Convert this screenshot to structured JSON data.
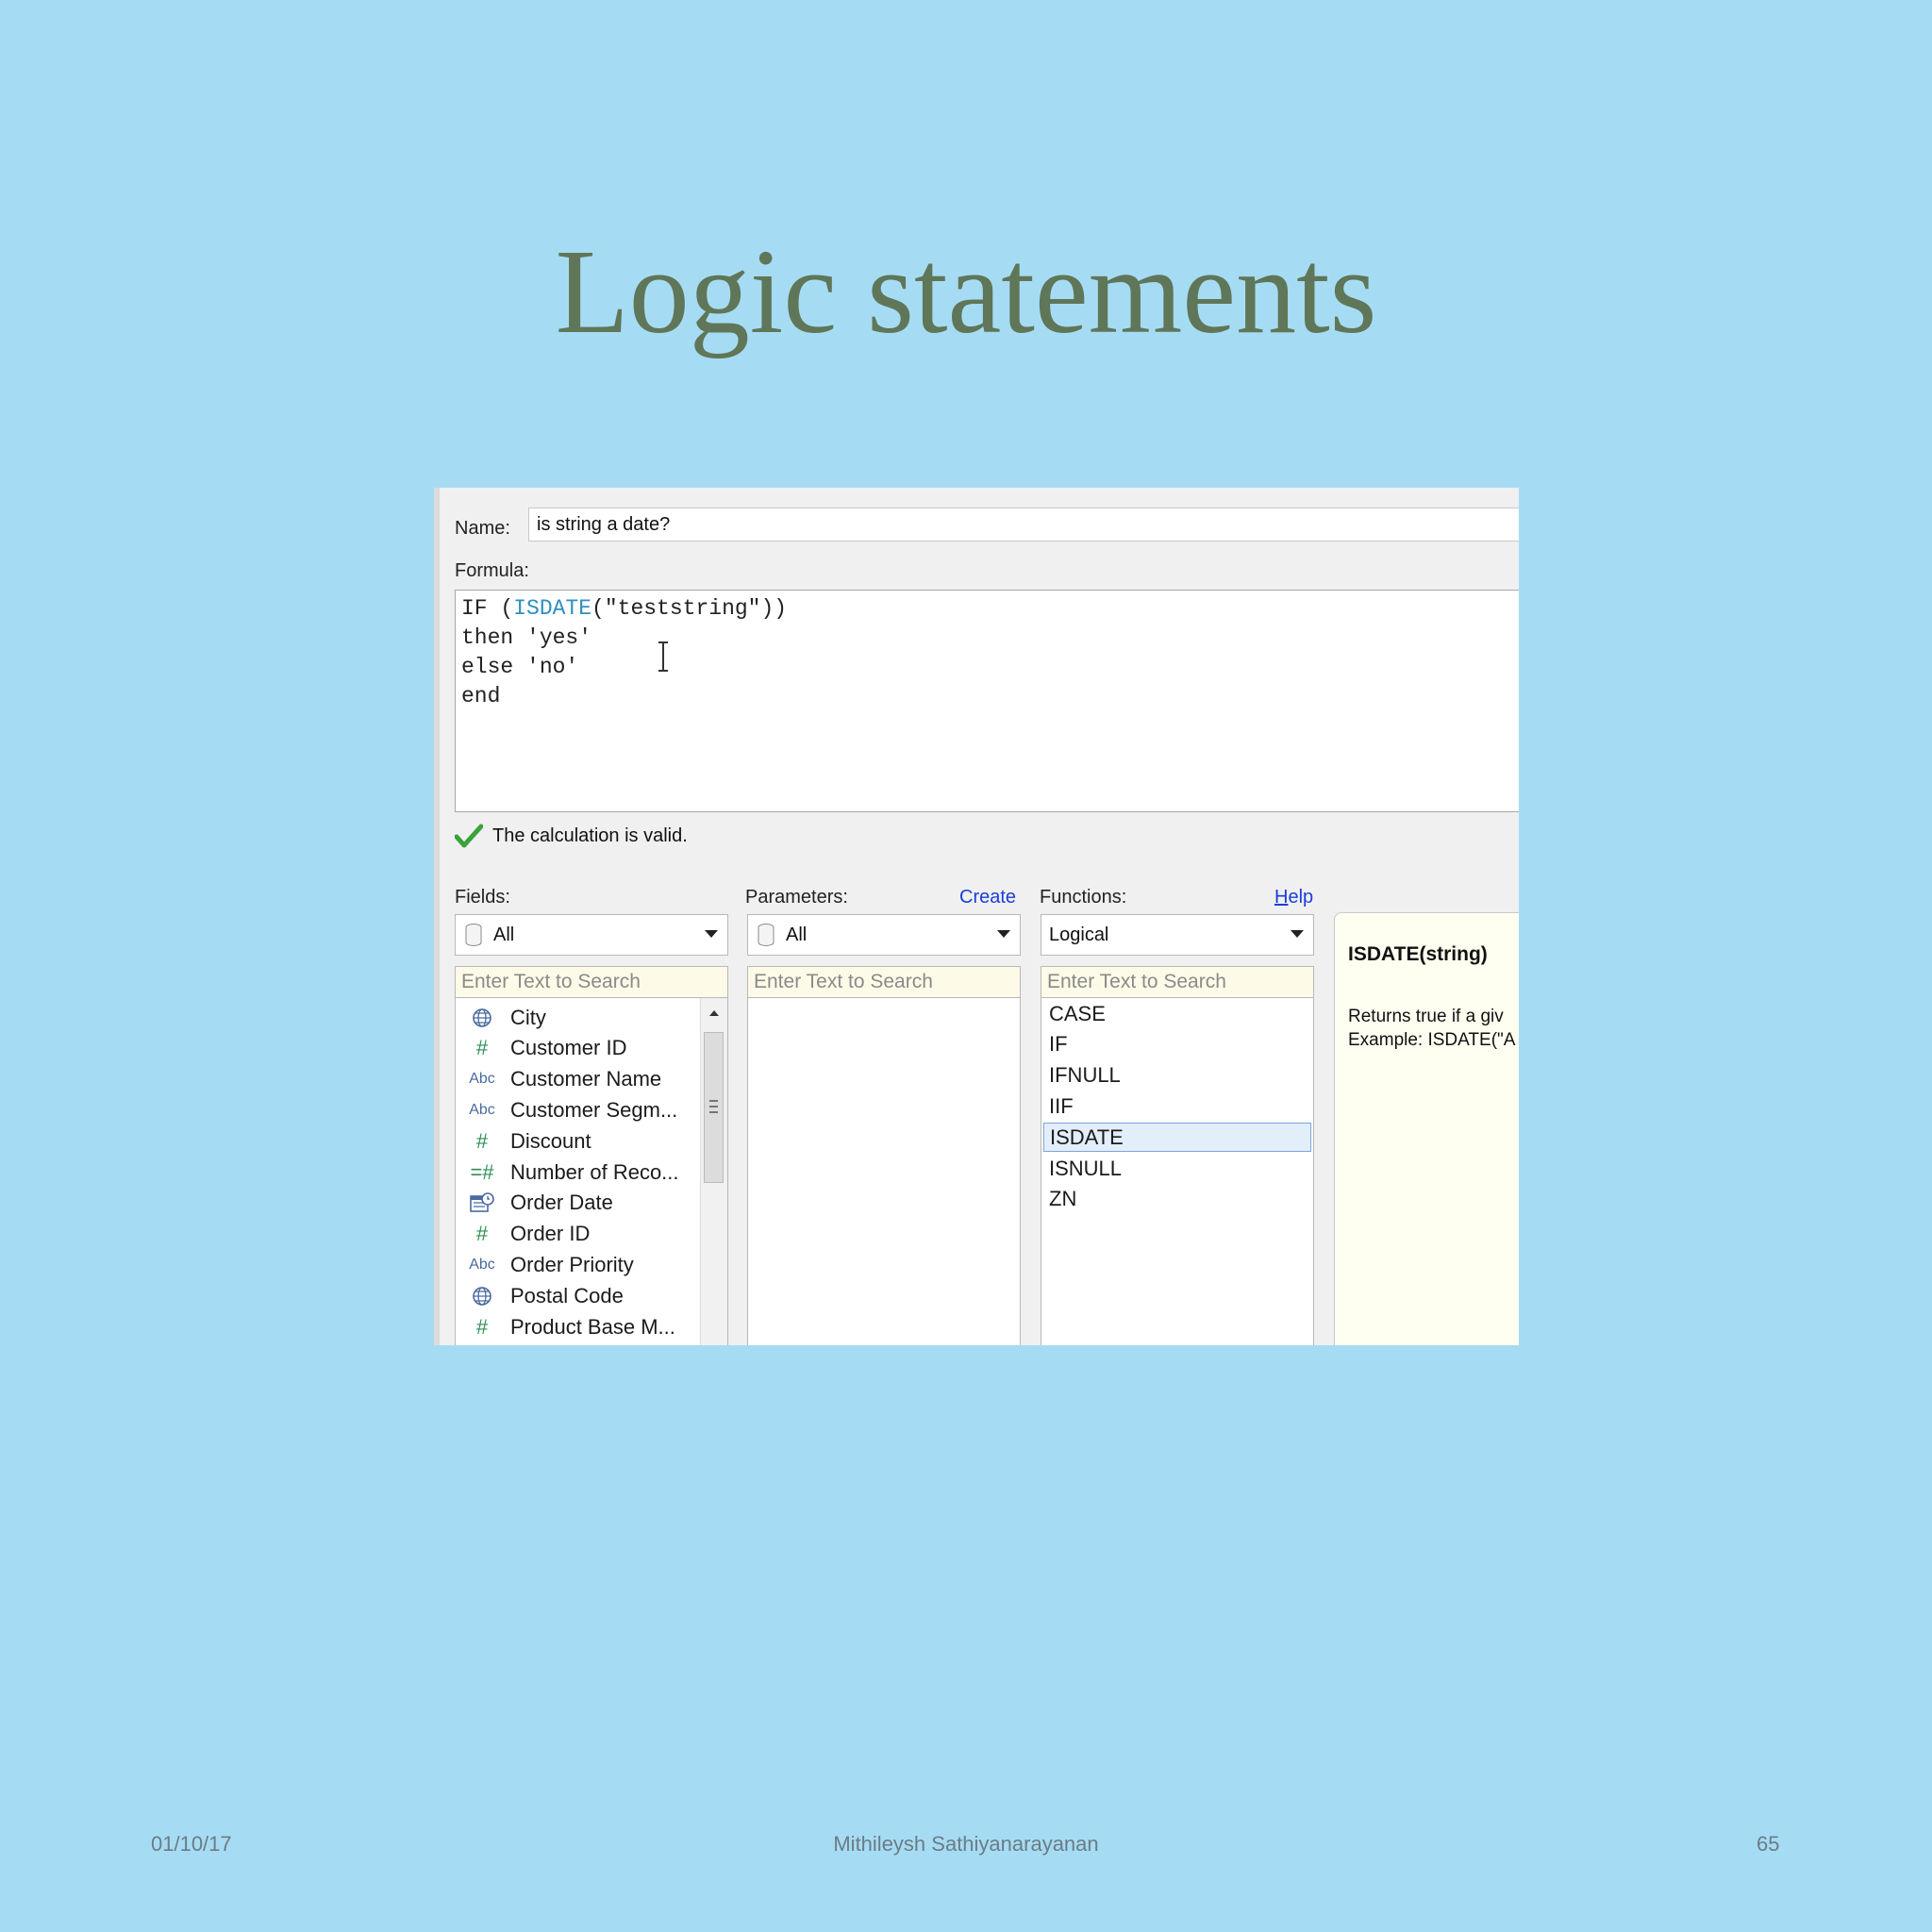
{
  "slide": {
    "title": "Logic statements",
    "footer": {
      "date": "01/10/17",
      "author": "Mithileysh Sathiyanarayanan",
      "page": "65"
    }
  },
  "dialog": {
    "name_label": "Name:",
    "name_value": "is string a date?",
    "formula_label": "Formula:",
    "formula": {
      "line1_kw": "IF (",
      "line1_fn": "ISDATE",
      "line1_rest": "(\"teststring\"))",
      "line2": "then 'yes'",
      "line3": "else 'no'",
      "line4": "end"
    },
    "valid_message": "The calculation is valid.",
    "fields": {
      "label": "Fields:",
      "filter": "All",
      "search_placeholder": "Enter Text to Search",
      "items": [
        {
          "icon": "globe-icon",
          "label": "City"
        },
        {
          "icon": "number-icon",
          "label": "Customer ID"
        },
        {
          "icon": "string-icon",
          "label": "Customer Name"
        },
        {
          "icon": "string-icon",
          "label": "Customer Segm..."
        },
        {
          "icon": "number-icon",
          "label": "Discount"
        },
        {
          "icon": "calculated-number-icon",
          "label": "Number of Reco..."
        },
        {
          "icon": "date-icon",
          "label": "Order Date"
        },
        {
          "icon": "number-icon",
          "label": "Order ID"
        },
        {
          "icon": "string-icon",
          "label": "Order Priority"
        },
        {
          "icon": "globe-icon",
          "label": "Postal Code"
        },
        {
          "icon": "number-icon",
          "label": "Product Base M..."
        }
      ]
    },
    "parameters": {
      "label": "Parameters:",
      "create_link": "Create",
      "filter": "All",
      "search_placeholder": "Enter Text to Search"
    },
    "functions": {
      "label": "Functions:",
      "help_link": "Help",
      "filter": "Logical",
      "search_placeholder": "Enter Text to Search",
      "items": [
        "CASE",
        "IF",
        "IFNULL",
        "IIF",
        "ISDATE",
        "ISNULL",
        "ZN"
      ],
      "selected": "ISDATE"
    },
    "help": {
      "title": "ISDATE(string)",
      "desc_line1": "Returns true if a giv",
      "desc_line2": "Example: ISDATE(\"A"
    },
    "icon_text": {
      "number": "#",
      "string": "Abc",
      "calc": "=#"
    },
    "colors": {
      "accent_link": "#1a3ed8",
      "function_keyword": "#2f8fc0",
      "valid_check": "#3aa23a"
    }
  }
}
